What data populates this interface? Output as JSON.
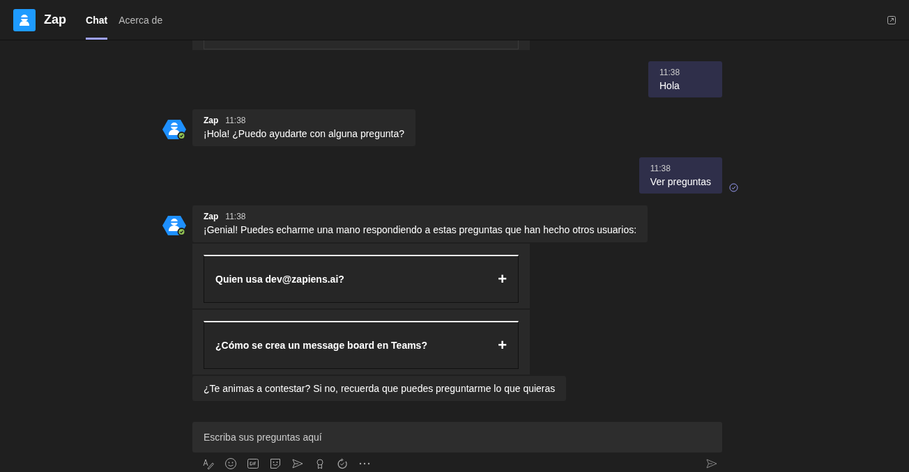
{
  "app": {
    "name": "Zap"
  },
  "tabs": [
    {
      "label": "Chat",
      "selected": true
    },
    {
      "label": "Acerca de",
      "selected": false
    }
  ],
  "messages": [
    {
      "kind": "cut_card"
    },
    {
      "kind": "outgoing",
      "time": "11:38",
      "text": "Hola",
      "read": false
    },
    {
      "kind": "incoming",
      "sender": "Zap",
      "time": "11:38",
      "text": "¡Hola! ¿Puedo ayudarte con alguna pregunta?"
    },
    {
      "kind": "outgoing",
      "time": "11:38",
      "text": "Ver preguntas",
      "read": true
    },
    {
      "kind": "incoming",
      "sender": "Zap",
      "time": "11:38",
      "text": "¡Genial! Puedes echarme una mano respondiendo a estas preguntas que han hecho otros usuarios:"
    },
    {
      "kind": "card",
      "title": "Quien usa dev@zapiens.ai?",
      "expand": "+"
    },
    {
      "kind": "card",
      "title": "¿Cómo se crea un message board en Teams?",
      "expand": "+"
    },
    {
      "kind": "text",
      "text": "¿Te animas a contestar? Si no, recuerda que puedes preguntarme lo que quieras"
    }
  ],
  "compose": {
    "placeholder": "Escriba sus preguntas aquí"
  }
}
